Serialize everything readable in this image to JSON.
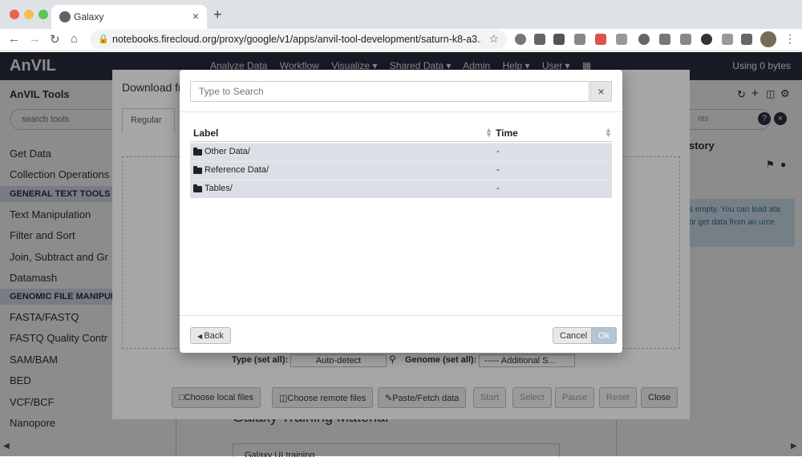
{
  "browser": {
    "tab_title": "Galaxy",
    "tab_close": "×",
    "new_tab": "+",
    "url": "notebooks.firecloud.org/proxy/google/v1/apps/anvil-tool-development/saturn-k8-a3...",
    "colors": {
      "close": "#ee5f57",
      "minimize": "#f5bd4f",
      "maximize": "#5fc453"
    }
  },
  "masthead": {
    "brand": "AnVIL",
    "nav": [
      "Analyze Data",
      "Workflow",
      "Visualize ▾",
      "Shared Data ▾",
      "Admin",
      "Help ▾",
      "User ▾"
    ],
    "usage": "Using 0 bytes"
  },
  "tool_panel": {
    "title": "AnVIL Tools",
    "search_placeholder": "search tools",
    "items": [
      {
        "type": "tool",
        "label": "Get Data"
      },
      {
        "type": "tool",
        "label": "Collection Operations"
      },
      {
        "type": "section",
        "label": "GENERAL TEXT TOOLS"
      },
      {
        "type": "tool",
        "label": "Text Manipulation"
      },
      {
        "type": "tool",
        "label": "Filter and Sort"
      },
      {
        "type": "tool",
        "label": "Join, Subtract and Gr"
      },
      {
        "type": "tool",
        "label": "Datamash"
      },
      {
        "type": "section",
        "label": "GENOMIC FILE MANIPUL"
      },
      {
        "type": "tool",
        "label": "FASTA/FASTQ"
      },
      {
        "type": "tool",
        "label": "FASTQ Quality Contr"
      },
      {
        "type": "tool",
        "label": "SAM/BAM"
      },
      {
        "type": "tool",
        "label": "BED"
      },
      {
        "type": "tool",
        "label": "VCF/BCF"
      },
      {
        "type": "tool",
        "label": "Nanopore"
      }
    ]
  },
  "history": {
    "title": "story",
    "search_placeholder": "nts",
    "empty_text": "s empty. You can load ata or get data from an urce"
  },
  "upload": {
    "title": "Download fr",
    "tab_regular": "Regular",
    "type_label": "Type (set all):",
    "type_value": "Auto-detect",
    "genome_label": "Genome (set all):",
    "genome_value": "----- Additional S...",
    "buttons": {
      "local": "Choose local files",
      "remote": "Choose remote files",
      "paste": "Paste/Fetch data",
      "start": "Start",
      "select": "Select",
      "pause": "Pause",
      "reset": "Reset",
      "close": "Close"
    },
    "background_text": "Galaxy Training Material",
    "background_sub": "Galaxy UI training"
  },
  "remote_modal": {
    "search_placeholder": "Type to Search",
    "clear": "×",
    "col_label": "Label",
    "col_time": "Time",
    "rows": [
      {
        "label": "Other Data/",
        "time": "-"
      },
      {
        "label": "Reference Data/",
        "time": "-"
      },
      {
        "label": "Tables/",
        "time": "-"
      }
    ],
    "back": "Back",
    "cancel": "Cancel",
    "ok": "Ok"
  }
}
